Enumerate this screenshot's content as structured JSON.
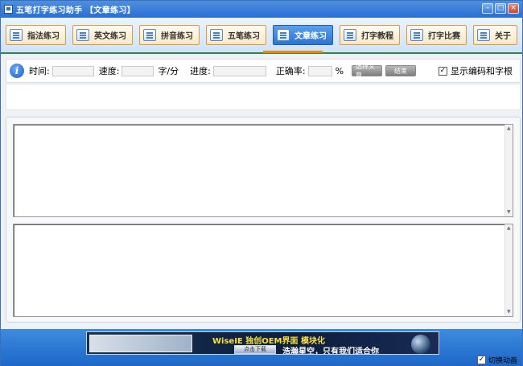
{
  "window": {
    "title": "五笔打字练习助手 【文章练习】",
    "buttons": [
      "–",
      "□",
      "×"
    ]
  },
  "tabs": [
    {
      "label": "指法练习",
      "active": false
    },
    {
      "label": "英文练习",
      "active": false
    },
    {
      "label": "拼音练习",
      "active": false
    },
    {
      "label": "五笔练习",
      "active": false
    },
    {
      "label": "文章练习",
      "active": true
    },
    {
      "label": "打字教程",
      "active": false
    },
    {
      "label": "打字比赛",
      "active": false
    },
    {
      "label": "关于",
      "active": false
    }
  ],
  "status": {
    "time_label": "时间:",
    "time_value": "",
    "speed_label": "速度:",
    "speed_value": "",
    "speed_unit": "字/分",
    "progress_label": "进度:",
    "progress_value": "",
    "accuracy_label": "正确率:",
    "accuracy_value": "",
    "accuracy_unit": "%",
    "select_article_button": "选择文章",
    "end_button": "结束",
    "show_code_checkbox": {
      "label": "显示编码和字根",
      "checked": true
    }
  },
  "banner": {
    "brand": "WiseIE 独创OEM界面 模块化",
    "slogan": "浩瀚星空，只有我们适合你",
    "cta": "点击下载"
  },
  "bottom": {
    "anim_checkbox": {
      "label": "切换动画",
      "checked": true
    }
  },
  "colors": {
    "accent": "#2c74d4",
    "tab_border": "#d79b3d",
    "green_line": "#2c8a3a",
    "orange_marker": "#e58a17"
  }
}
